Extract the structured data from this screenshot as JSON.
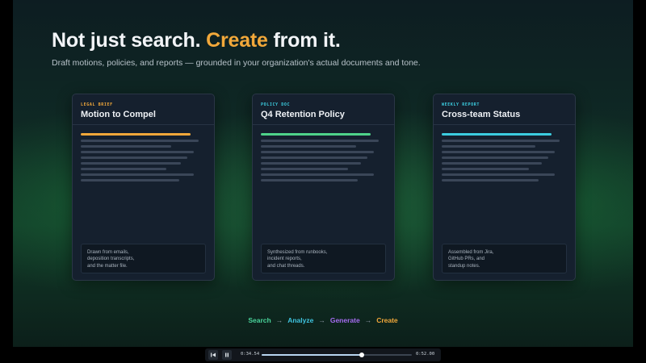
{
  "hero": {
    "headline_pre": "Not just search. ",
    "headline_accent": "Create",
    "headline_post": " from it.",
    "subtitle": "Draft motions, policies, and reports — grounded in your organization's actual documents and tone."
  },
  "cards": [
    {
      "eyebrow": "LEGAL BRIEF",
      "title": "Motion to Compel",
      "note": "Drawn from emails,\ndeposition transcripts,\nand the matter file.",
      "color": "#f2a83a"
    },
    {
      "eyebrow": "POLICY DOC",
      "title": "Q4 Retention Policy",
      "note": "Synthesized from runbooks,\nincident reports,\nand chat threads.",
      "color": "#4fd38a"
    },
    {
      "eyebrow": "WEEKLY REPORT",
      "title": "Cross-team Status",
      "note": "Assembled from Jira,\nGitHub PRs, and\nstandup notes.",
      "color": "#3ccde0"
    }
  ],
  "flow": {
    "steps": [
      {
        "label": "Search",
        "color": "#49d39a"
      },
      {
        "label": "Analyze",
        "color": "#3fc4e0"
      },
      {
        "label": "Generate",
        "color": "#a56cf0"
      },
      {
        "label": "Create",
        "color": "#f2a83a"
      }
    ],
    "arrow": "→"
  },
  "player": {
    "current_time": "0:34.54",
    "total_time": "0:52.00",
    "progress": 0.664,
    "rewind_icon": "skip-back-icon",
    "pause_icon": "pause-icon"
  }
}
